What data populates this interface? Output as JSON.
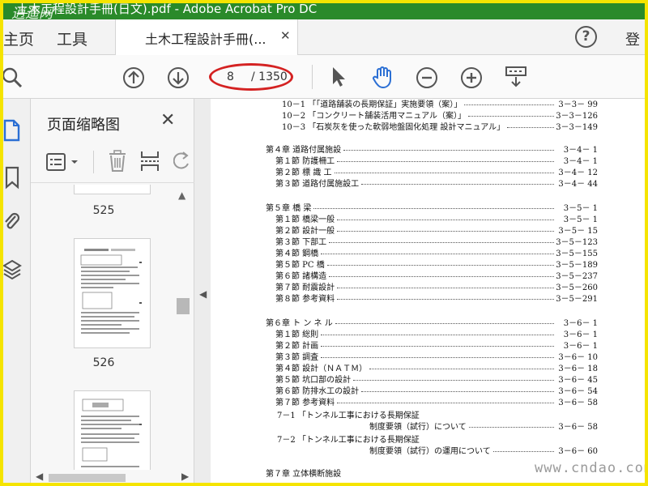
{
  "window": {
    "title": "土木工程設計手冊(日文).pdf - Adobe Acrobat Pro DC",
    "watermark": "逍遥网"
  },
  "tabs": {
    "home": "主页",
    "tools": "工具",
    "document": "土木工程設計手冊(...",
    "signin": "登"
  },
  "toolbar": {
    "current_page": "8",
    "total_pages": "/ 1350"
  },
  "panel": {
    "title": "页面缩略图",
    "thumbnails": [
      "525",
      "526"
    ]
  },
  "toc": [
    {
      "text": "10－1 「「道路舗装の長期保証」実施要領（案）」",
      "page": "3－3－ 99"
    },
    {
      "text": "10－2 「コンクリート舗装活用マニュアル（案）」",
      "page": "3－3－126"
    },
    {
      "text": "10－3 「石炭灰を使った軟弱地盤固化処理 設計マニュアル」",
      "page": "3－3－149"
    },
    {
      "text": "第４章 道路付属施設",
      "page": "3－4－ 1"
    },
    {
      "text": "第１節 防護柵工",
      "page": "3－4－ 1"
    },
    {
      "text": "第２節 標 識 工",
      "page": "3－4－ 12"
    },
    {
      "text": "第３節 道路付属施設工",
      "page": "3－4－ 44"
    },
    {
      "text": "第５章 橋 梁",
      "page": "3－5－ 1"
    },
    {
      "text": "第１節 橋梁一般",
      "page": "3－5－ 1"
    },
    {
      "text": "第２節 設計一般",
      "page": "3－5－ 15"
    },
    {
      "text": "第３節 下部工",
      "page": "3－5－123"
    },
    {
      "text": "第４節 鋼橋",
      "page": "3－5－155"
    },
    {
      "text": "第５節 PC 橋",
      "page": "3－5－189"
    },
    {
      "text": "第６節 諸構造",
      "page": "3－5－237"
    },
    {
      "text": "第７節 耐震設計",
      "page": "3－5－260"
    },
    {
      "text": "第８節 参考資料",
      "page": "3－5－291"
    },
    {
      "text": "第６章 ト ン ネ ル",
      "page": "3－6－ 1"
    },
    {
      "text": "第１節 総則",
      "page": "3－6－ 1"
    },
    {
      "text": "第２節 計画",
      "page": "3－6－ 1"
    },
    {
      "text": "第３節 調査",
      "page": "3－6－ 10"
    },
    {
      "text": "第４節 設計（ＮＡＴＭ）",
      "page": "3－6－ 18"
    },
    {
      "text": "第５節 坑口部の設計",
      "page": "3－6－ 45"
    },
    {
      "text": "第６節 防排水工の設計",
      "page": "3－6－ 54"
    },
    {
      "text": "第７節 参考資料",
      "page": "3－6－ 58"
    },
    {
      "text": "7－1 「トンネル工事における長期保証",
      "page": ""
    },
    {
      "text": "制度要領（試行）について",
      "page": "3－6－ 58"
    },
    {
      "text": "7－2 「トンネル工事における長期保証",
      "page": ""
    },
    {
      "text": "制度要領（試行）の運用について",
      "page": "3－6－ 60"
    },
    {
      "text": "第７章 立体横断施設",
      "page": ""
    }
  ],
  "site_watermark": "www.cndao.com",
  "colors": {
    "titlebar": "#2a8a2a",
    "frame": "#f5e400",
    "annotation_ring": "#d42222",
    "hand_tool": "#2b6fd4"
  }
}
